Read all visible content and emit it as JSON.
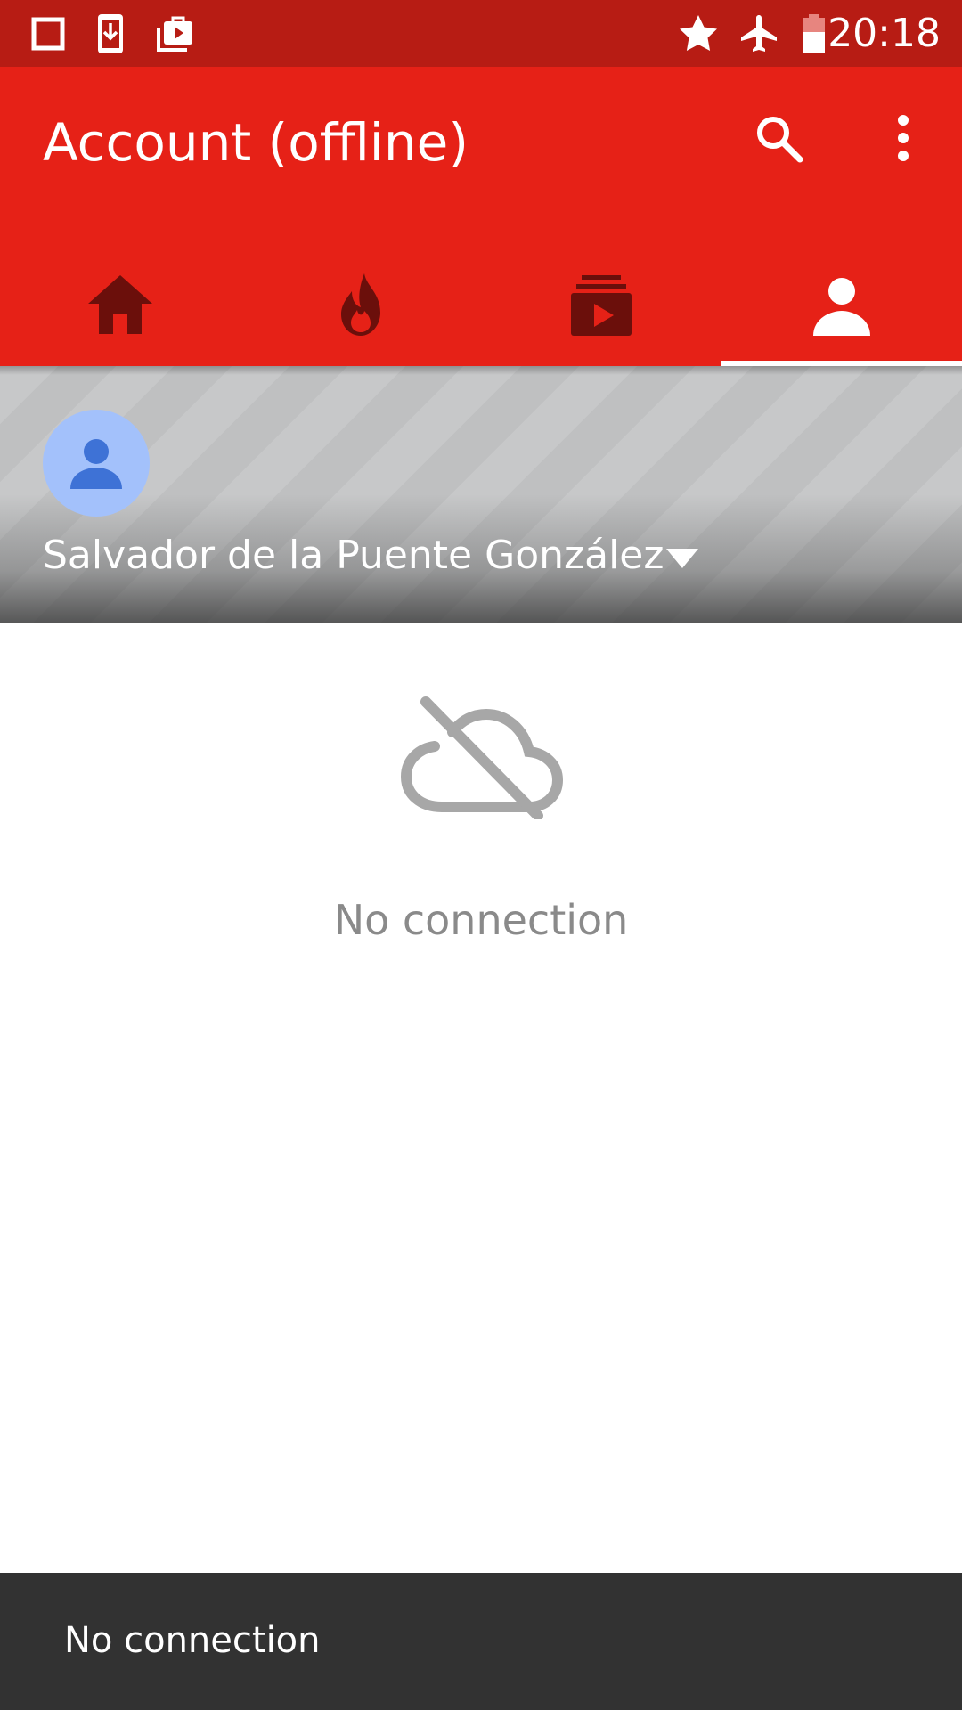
{
  "status_bar": {
    "time": "20:18",
    "left_icons": [
      "square-notification-icon",
      "download-notification-icon",
      "media-notification-icon"
    ],
    "right_icons": [
      "star-icon",
      "airplane-mode-icon",
      "battery-icon"
    ]
  },
  "app_bar": {
    "title": "Account (offline)",
    "actions": [
      "search-icon",
      "more-vert-icon"
    ],
    "background": "#e62117"
  },
  "tabs": [
    {
      "icon": "home-icon",
      "selected": false
    },
    {
      "icon": "trending-icon",
      "selected": false
    },
    {
      "icon": "subscriptions-icon",
      "selected": false
    },
    {
      "icon": "account-icon",
      "selected": true
    }
  ],
  "account": {
    "name": "Salvador de la Puente González",
    "avatar_icon": "person-icon",
    "avatar_color": "#a3c1fb"
  },
  "empty_state": {
    "icon": "cloud-off-icon",
    "message": "No connection"
  },
  "snackbar": {
    "message": "No connection"
  }
}
